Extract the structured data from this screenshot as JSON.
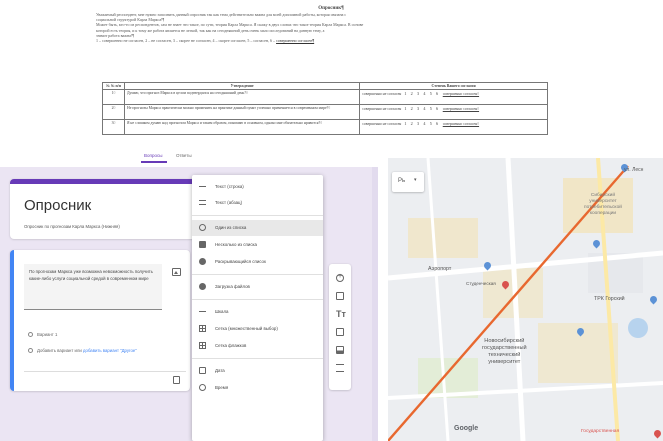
{
  "document": {
    "title": "Опросник¶",
    "paragraphs": [
      "Уважаемый респондент, мне нужно заполнить данный опросник так как тема действительно важна для моей дипломной работы, которая связана с",
      "социальной структурой Карла Маркса!¶",
      "Может быть, кто-то из респондентов, сам не знает что такое, по сути, теория Карла Маркса. Я скажу в двух словах что такое теория Карла Маркса. В основе",
      "которой есть теория, и к тому же работа является не легкой, так как на сегодняшний день очень мало исследований на данную тему, а",
      "значит работа важна!¶"
    ],
    "scale_line": "1 – совершенно не согласен, 2 – не согласен, 3 – скорее не согласен, 4 – скорее согласен, 5 – согласен, 6 –",
    "scale_end": "совершенно согласен¶",
    "table": {
      "headers": [
        "№ № п/п",
        "Утверждение",
        "Степень Вашего согласия"
      ],
      "rows": [
        {
          "num": "1¤",
          "statement": "Думаю, что прогноз Маркса в целом подтвердился на сегодняшний день?¤",
          "left": "совершенно не согласен",
          "scale": "1 2 3 4 5 6",
          "right": "совершенно согласен¤"
        },
        {
          "num": "2¤",
          "statement": "Не прогнозы Маркса практически можно применить на практике данный пункт успешно применяется в современном мире?¤",
          "left": "совершенно не согласен",
          "scale": "1 2 3 4 5 6",
          "right": "совершенно согласен¤"
        },
        {
          "num": "3¤",
          "statement": "Я не слишком думаю над прогнозом Маркса и таким образом, понимаю в основном, однако мне обязательно нравится?¤",
          "left": "совершенно не согласен",
          "scale": "1 2 3 4 5 6",
          "right": "совершенно согласен¤"
        }
      ]
    }
  },
  "forms": {
    "tabs": {
      "questions": "Вопросы",
      "answers": "Ответы"
    },
    "title": "Опросник",
    "description": "Опросник по прогнозам Карла Маркса (Нижняя)",
    "question": {
      "text": "По прогнозам Маркса уже возможна невозможность получить какие-либо услуги социальной средой в современном мире",
      "option1": "Вариант 1",
      "option2_prefix": "Добавить вариант или",
      "option2_link": "добавить вариант \"Другое\""
    },
    "type_menu": {
      "items": [
        {
          "label": "Текст (строка)",
          "icon": "short-text-icon"
        },
        {
          "label": "Текст (абзац)",
          "icon": "paragraph-icon"
        },
        {
          "label": "Один из списка",
          "icon": "radio-icon",
          "selected": true
        },
        {
          "label": "Несколько из списка",
          "icon": "checkbox-icon"
        },
        {
          "label": "Раскрывающийся список",
          "icon": "dropdown-icon"
        },
        {
          "label": "Загрузка файлов",
          "icon": "upload-icon"
        },
        {
          "label": "Шкала",
          "icon": "scale-icon"
        },
        {
          "label": "Сетка (множественный выбор)",
          "icon": "grid-icon"
        },
        {
          "label": "Сетка флажков",
          "icon": "checkbox-grid-icon"
        },
        {
          "label": "Дата",
          "icon": "date-icon"
        },
        {
          "label": "Время",
          "icon": "time-icon"
        }
      ]
    }
  },
  "map": {
    "map_type_label": "Рь",
    "labels": {
      "street": "ул. Лесн",
      "sibgufk": "Сибирский\nуниверситет\nпотребительской\nкооперации",
      "aero": "Аэропорт",
      "students": "Студенческая",
      "trk": "ТРК Горский",
      "university": "Новосибирский\nгосударственный\nтехнический\nуниверситет",
      "google": "Google",
      "gosud": "Государственная"
    },
    "colors": {
      "route": "#e8682f",
      "water": "#b7d3ee",
      "buildings": "#f1e2b8",
      "roads": "#ffffff"
    }
  }
}
